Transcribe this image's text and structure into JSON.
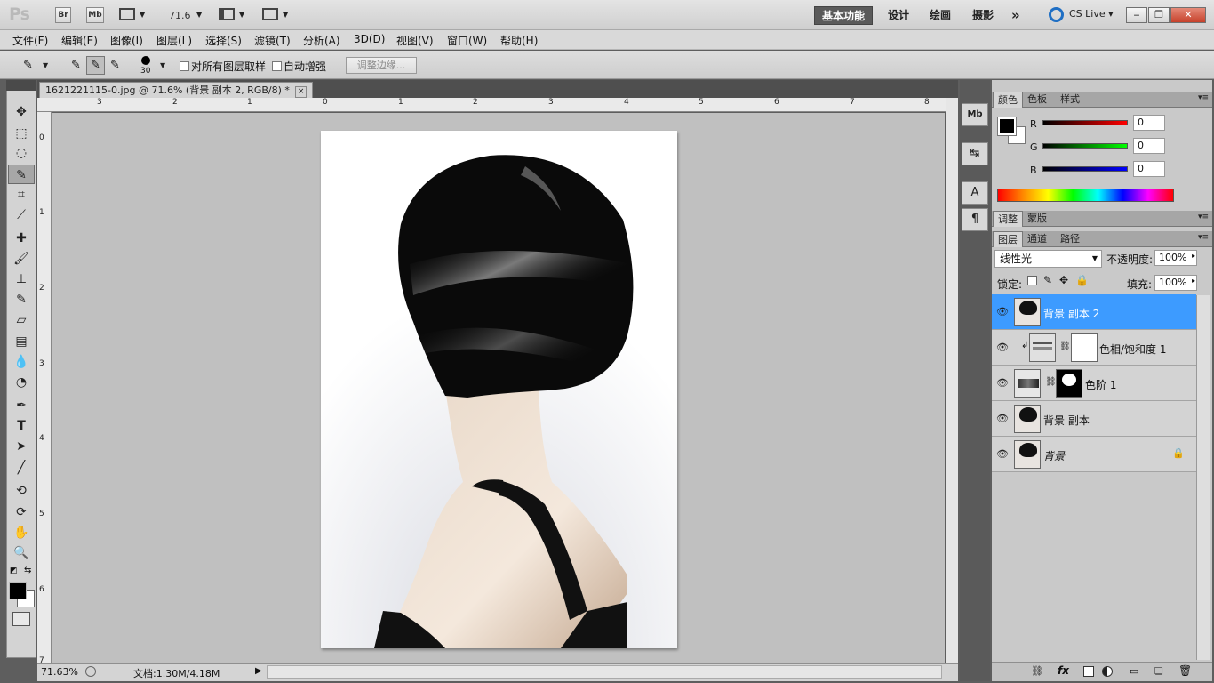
{
  "appbar": {
    "logo": "Ps",
    "bridge_label": "Br",
    "minibridge_label": "Mb",
    "zoom": "71.6",
    "workspaces": [
      "基本功能",
      "设计",
      "绘画",
      "摄影"
    ],
    "more": "»",
    "cslive": "CS Live"
  },
  "menu": [
    "文件(F)",
    "编辑(E)",
    "图像(I)",
    "图层(L)",
    "选择(S)",
    "滤镜(T)",
    "分析(A)",
    "3D(D)",
    "视图(V)",
    "窗口(W)",
    "帮助(H)"
  ],
  "options": {
    "brush_size": "30",
    "sample_all": "对所有图层取样",
    "auto_enhance": "自动增强",
    "refine_edge": "调整边缘..."
  },
  "document": {
    "tab_title": "1621221115-0.jpg @ 71.6% (背景 副本 2, RGB/8) *",
    "close": "×"
  },
  "ruler": {
    "h": [
      "3",
      "2",
      "1",
      "0",
      "1",
      "2",
      "3",
      "4",
      "5",
      "6",
      "7",
      "8"
    ],
    "v": [
      "0",
      "1",
      "2",
      "3",
      "4",
      "5",
      "6",
      "7"
    ]
  },
  "status": {
    "zoom": "71.63%",
    "doc": "文档:1.30M/4.18M"
  },
  "color_panel": {
    "tabs": [
      "颜色",
      "色板",
      "样式"
    ],
    "r_label": "R",
    "g_label": "G",
    "b_label": "B",
    "r": "0",
    "g": "0",
    "b": "0",
    "foreground": "#000000",
    "background": "#ffffff"
  },
  "adjust_panel": {
    "tabs": [
      "调整",
      "蒙版"
    ]
  },
  "layers_panel": {
    "tabs": [
      "图层",
      "通道",
      "路径"
    ],
    "blend_mode": "线性光",
    "opacity_label": "不透明度:",
    "opacity": "100%",
    "lock_label": "锁定:",
    "fill_label": "填充:",
    "fill": "100%",
    "layers": [
      {
        "name": "背景 副本 2",
        "selected": true
      },
      {
        "name": "色相/饱和度 1",
        "selected": false
      },
      {
        "name": "色阶 1",
        "selected": false
      },
      {
        "name": "背景 副本",
        "selected": false
      },
      {
        "name": "背景",
        "selected": false
      }
    ],
    "footer_icons": [
      "link-icon",
      "fx-icon",
      "mask-icon",
      "adjustment-icon",
      "group-icon",
      "new-layer-icon",
      "trash-icon"
    ],
    "fx": "fx"
  }
}
